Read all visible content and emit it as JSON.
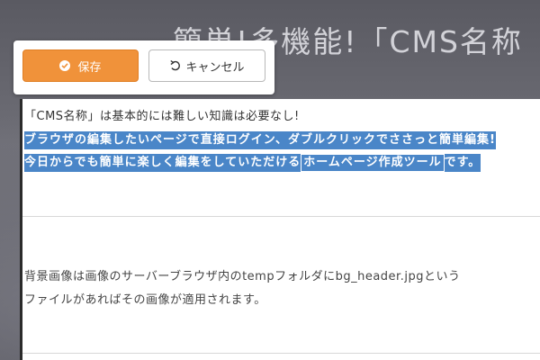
{
  "hero": {
    "title": "簡単!多機能!「CMS名称"
  },
  "toolbar": {
    "save_label": "保存",
    "cancel_label": "キャンセル",
    "save_color": "#f0923a"
  },
  "editor": {
    "line1": "「CMS名称」は基本的には難しい知識は必要なし!",
    "line2": "ブラウザの編集したいページで直接ログイン、ダブルクリックでささっと簡単編集!",
    "line3_prefix": "今日からでも簡単に楽しく編集をしていただける",
    "line3_strong": "ホームページ作成ツール",
    "line3_suffix": "です。",
    "paragraph_line1": "背景画像は画像のサーバーブラウザ内のtempフォルダにbg_header.jpgという",
    "paragraph_line2": "ファイルがあればその画像が適用されます。",
    "selection_color": "#4a86c8"
  }
}
